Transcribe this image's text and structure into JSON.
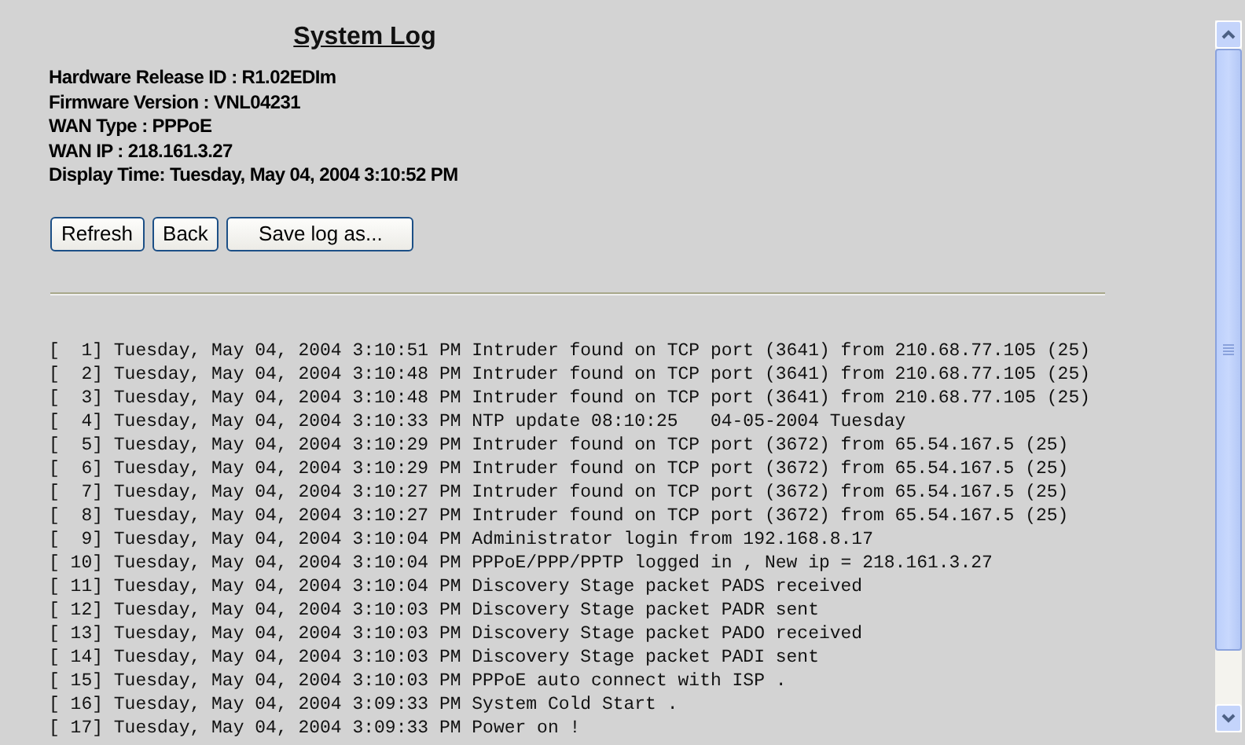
{
  "title": "System Log",
  "info": [
    "Hardware Release ID : R1.02EDIm",
    "Firmware Version : VNL04231",
    "WAN Type : PPPoE",
    "WAN IP : 218.161.3.27",
    "Display Time: Tuesday, May 04, 2004 3:10:52 PM"
  ],
  "buttons": [
    "Refresh",
    "Back",
    "Save log as..."
  ],
  "log": [
    "[  1] Tuesday, May 04, 2004 3:10:51 PM Intruder found on TCP port (3641) from 210.68.77.105 (25)",
    "[  2] Tuesday, May 04, 2004 3:10:48 PM Intruder found on TCP port (3641) from 210.68.77.105 (25)",
    "[  3] Tuesday, May 04, 2004 3:10:48 PM Intruder found on TCP port (3641) from 210.68.77.105 (25)",
    "[  4] Tuesday, May 04, 2004 3:10:33 PM NTP update 08:10:25   04-05-2004 Tuesday",
    "[  5] Tuesday, May 04, 2004 3:10:29 PM Intruder found on TCP port (3672) from 65.54.167.5 (25)",
    "[  6] Tuesday, May 04, 2004 3:10:29 PM Intruder found on TCP port (3672) from 65.54.167.5 (25)",
    "[  7] Tuesday, May 04, 2004 3:10:27 PM Intruder found on TCP port (3672) from 65.54.167.5 (25)",
    "[  8] Tuesday, May 04, 2004 3:10:27 PM Intruder found on TCP port (3672) from 65.54.167.5 (25)",
    "[  9] Tuesday, May 04, 2004 3:10:04 PM Administrator login from 192.168.8.17",
    "[ 10] Tuesday, May 04, 2004 3:10:04 PM PPPoE/PPP/PPTP logged in , New ip = 218.161.3.27",
    "[ 11] Tuesday, May 04, 2004 3:10:04 PM Discovery Stage packet PADS received",
    "[ 12] Tuesday, May 04, 2004 3:10:03 PM Discovery Stage packet PADR sent",
    "[ 13] Tuesday, May 04, 2004 3:10:03 PM Discovery Stage packet PADO received",
    "[ 14] Tuesday, May 04, 2004 3:10:03 PM Discovery Stage packet PADI sent",
    "[ 15] Tuesday, May 04, 2004 3:10:03 PM PPPoE auto connect with ISP .",
    "[ 16] Tuesday, May 04, 2004 3:09:33 PM System Cold Start .",
    "[ 17] Tuesday, May 04, 2004 3:09:33 PM Power on !"
  ]
}
